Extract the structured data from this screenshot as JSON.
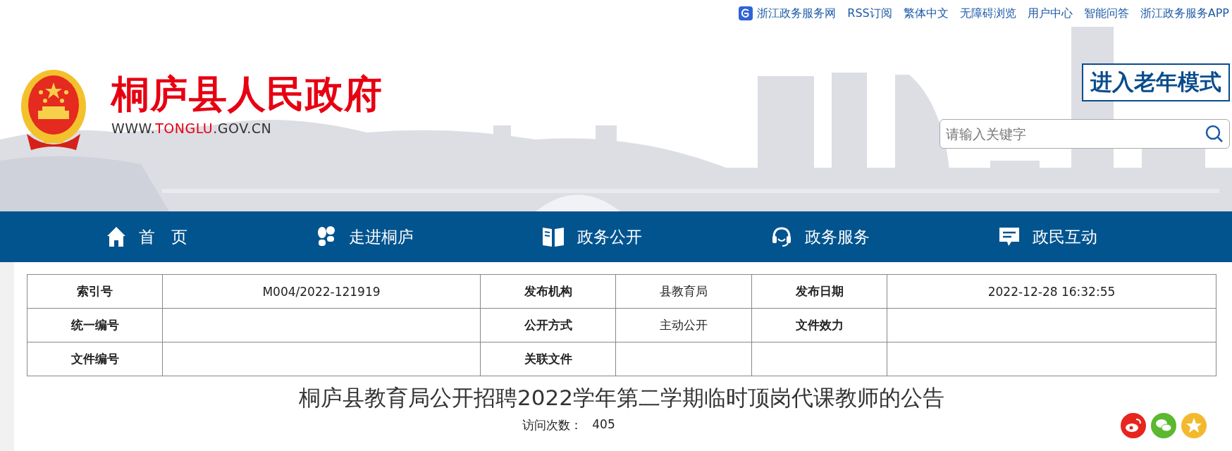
{
  "top_links": [
    {
      "label": "浙江政务服务网",
      "kind": "app"
    },
    {
      "label": "RSS订阅",
      "kind": "text"
    },
    {
      "label": "繁体中文",
      "kind": "text"
    },
    {
      "label": "无障碍浏览",
      "kind": "text"
    },
    {
      "label": "用户中心",
      "kind": "text"
    },
    {
      "label": "智能问答",
      "kind": "text"
    },
    {
      "label": "浙江政务服务APP",
      "kind": "text"
    }
  ],
  "header": {
    "site_title": "桐庐县人民政府",
    "url_parts": [
      {
        "text": "WWW.",
        "highlight": false
      },
      {
        "text": "TONGLU",
        "highlight": true
      },
      {
        "text": ".GOV.CN",
        "highlight": false
      }
    ],
    "elder_mode_button": "进入老年模式",
    "search": {
      "placeholder": "请输入关键字"
    }
  },
  "nav": [
    {
      "label": "首　页",
      "kind": "home"
    },
    {
      "label": "走进桐庐",
      "kind": "steps"
    },
    {
      "label": "政务公开",
      "kind": "book"
    },
    {
      "label": "政务服务",
      "kind": "headset"
    },
    {
      "label": "政民互动",
      "kind": "message"
    }
  ],
  "info_table": {
    "rows": [
      {
        "cells": [
          {
            "kind": "label",
            "text": "索引号"
          },
          {
            "kind": "value",
            "text": "M004/2022-121919"
          },
          {
            "kind": "label",
            "text": "发布机构"
          },
          {
            "kind": "value",
            "text": "县教育局"
          },
          {
            "kind": "label",
            "text": "发布日期"
          },
          {
            "kind": "value",
            "text": "2022-12-28 16:32:55"
          }
        ]
      },
      {
        "cells": [
          {
            "kind": "label",
            "text": "统一编号"
          },
          {
            "kind": "value"
          },
          {
            "kind": "label",
            "text": "公开方式"
          },
          {
            "kind": "value",
            "text": "主动公开"
          },
          {
            "kind": "label",
            "text": "文件效力"
          },
          {
            "kind": "value"
          }
        ]
      },
      {
        "cells": [
          {
            "kind": "label",
            "text": "文件编号"
          },
          {
            "kind": "value"
          },
          {
            "kind": "label",
            "text": "关联文件"
          },
          {
            "kind": "value"
          },
          {
            "kind": "value"
          },
          {
            "kind": "value"
          }
        ]
      }
    ]
  },
  "article": {
    "title": "桐庐县教育局公开招聘2022学年第二学期临时顶岗代课教师的公告",
    "visit_label": "访问次数：",
    "visit_count": "405",
    "share": [
      {
        "kind": "weibo"
      },
      {
        "kind": "wechat"
      },
      {
        "kind": "qzone"
      }
    ]
  }
}
